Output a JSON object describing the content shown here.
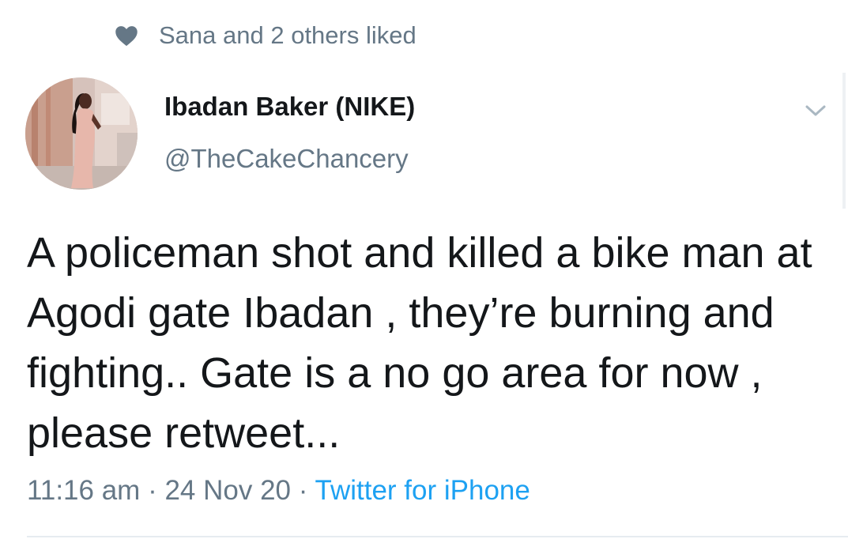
{
  "social_context": {
    "icon": "heart-icon",
    "text": "Sana and 2 others liked"
  },
  "author": {
    "display_name": "Ibadan Baker (NIKE)",
    "handle": "@TheCakeChancery",
    "avatar_icon": "profile-photo"
  },
  "tweet": {
    "text": "A policeman shot and killed a bike man at Agodi gate Ibadan , they’re burning and fighting.. Gate is a no go area for now , please retweet...",
    "time": "11:16 am",
    "separator": "·",
    "date": "24 Nov 20",
    "source": "Twitter for iPhone"
  },
  "menu": {
    "icon": "chevron-down-icon"
  },
  "colors": {
    "text_primary": "#14171a",
    "text_secondary": "#657786",
    "link": "#1da1f2",
    "divider": "#e6ecf0"
  }
}
